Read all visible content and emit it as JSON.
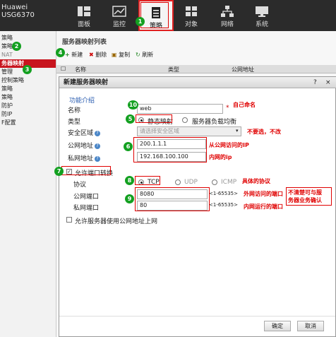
{
  "brand": {
    "line1": "Huawei",
    "line2": "USG6370"
  },
  "topnav": [
    {
      "label": "面板",
      "icon": "dashboard-icon"
    },
    {
      "label": "监控",
      "icon": "chart-icon"
    },
    {
      "label": "策略",
      "icon": "document-icon"
    },
    {
      "label": "对象",
      "icon": "objects-icon"
    },
    {
      "label": "网络",
      "icon": "network-icon"
    },
    {
      "label": "系统",
      "icon": "monitor-icon"
    }
  ],
  "leftnav": [
    "策略",
    "策略",
    "NAT",
    "务器映射",
    "管理",
    "控制策略",
    "策略",
    "策略",
    "防护",
    "防IP",
    "F配置"
  ],
  "panel_title": "服务器映射列表",
  "toolbar": {
    "new": "新建",
    "delete": "删除",
    "copy": "复制",
    "refresh": "刷新"
  },
  "table_headers": {
    "name": "名称",
    "type": "类型",
    "public": "公网地址"
  },
  "dialog": {
    "title": "新建服务器映射",
    "close_q": "?",
    "close_x": "×",
    "intro": "功能介绍",
    "name_label": "名称",
    "name_value": "web",
    "name_required": "*",
    "type_label": "类型",
    "type_static": "静态映射",
    "type_lb": "服务器负载均衡",
    "zone_label": "安全区域",
    "zone_placeholder": "请选择安全区域",
    "public_label": "公网地址",
    "public_value": "200.1.1.1",
    "private_label": "私网地址",
    "private_value": "192.168.100.100",
    "port_trans": "允许端口转换",
    "protocol_label": "协议",
    "proto_tcp": "TCP",
    "proto_udp": "UDP",
    "proto_icmp": "ICMP",
    "public_port_label": "公网端口",
    "public_port_value": "8080",
    "public_port_range": "<1-65535>",
    "private_port_label": "私网端口",
    "private_port_value": "80",
    "private_port_range": "<1-65535>",
    "allow_public": "允许服务器使用公网地址上网",
    "ok": "确定",
    "cancel": "取消"
  },
  "annotations": {
    "a1": "自己命名",
    "a2": "不要选，不改",
    "a3": "从公网访问的IP",
    "a4": "内网的ip",
    "a5": "具体的协议",
    "a6": "外网访问的端口",
    "a7": "内网运行的端口",
    "a8a": "不清楚可与服",
    "a8b": "务器业务确认"
  },
  "badges": [
    "1",
    "2",
    "3",
    "4",
    "5",
    "6",
    "7",
    "8",
    "9",
    "10"
  ],
  "colors": {
    "accent_red": "#c8141e",
    "annotation_red": "#e00000",
    "badge_green": "#13a020",
    "topbar": "#2b2b2b"
  }
}
